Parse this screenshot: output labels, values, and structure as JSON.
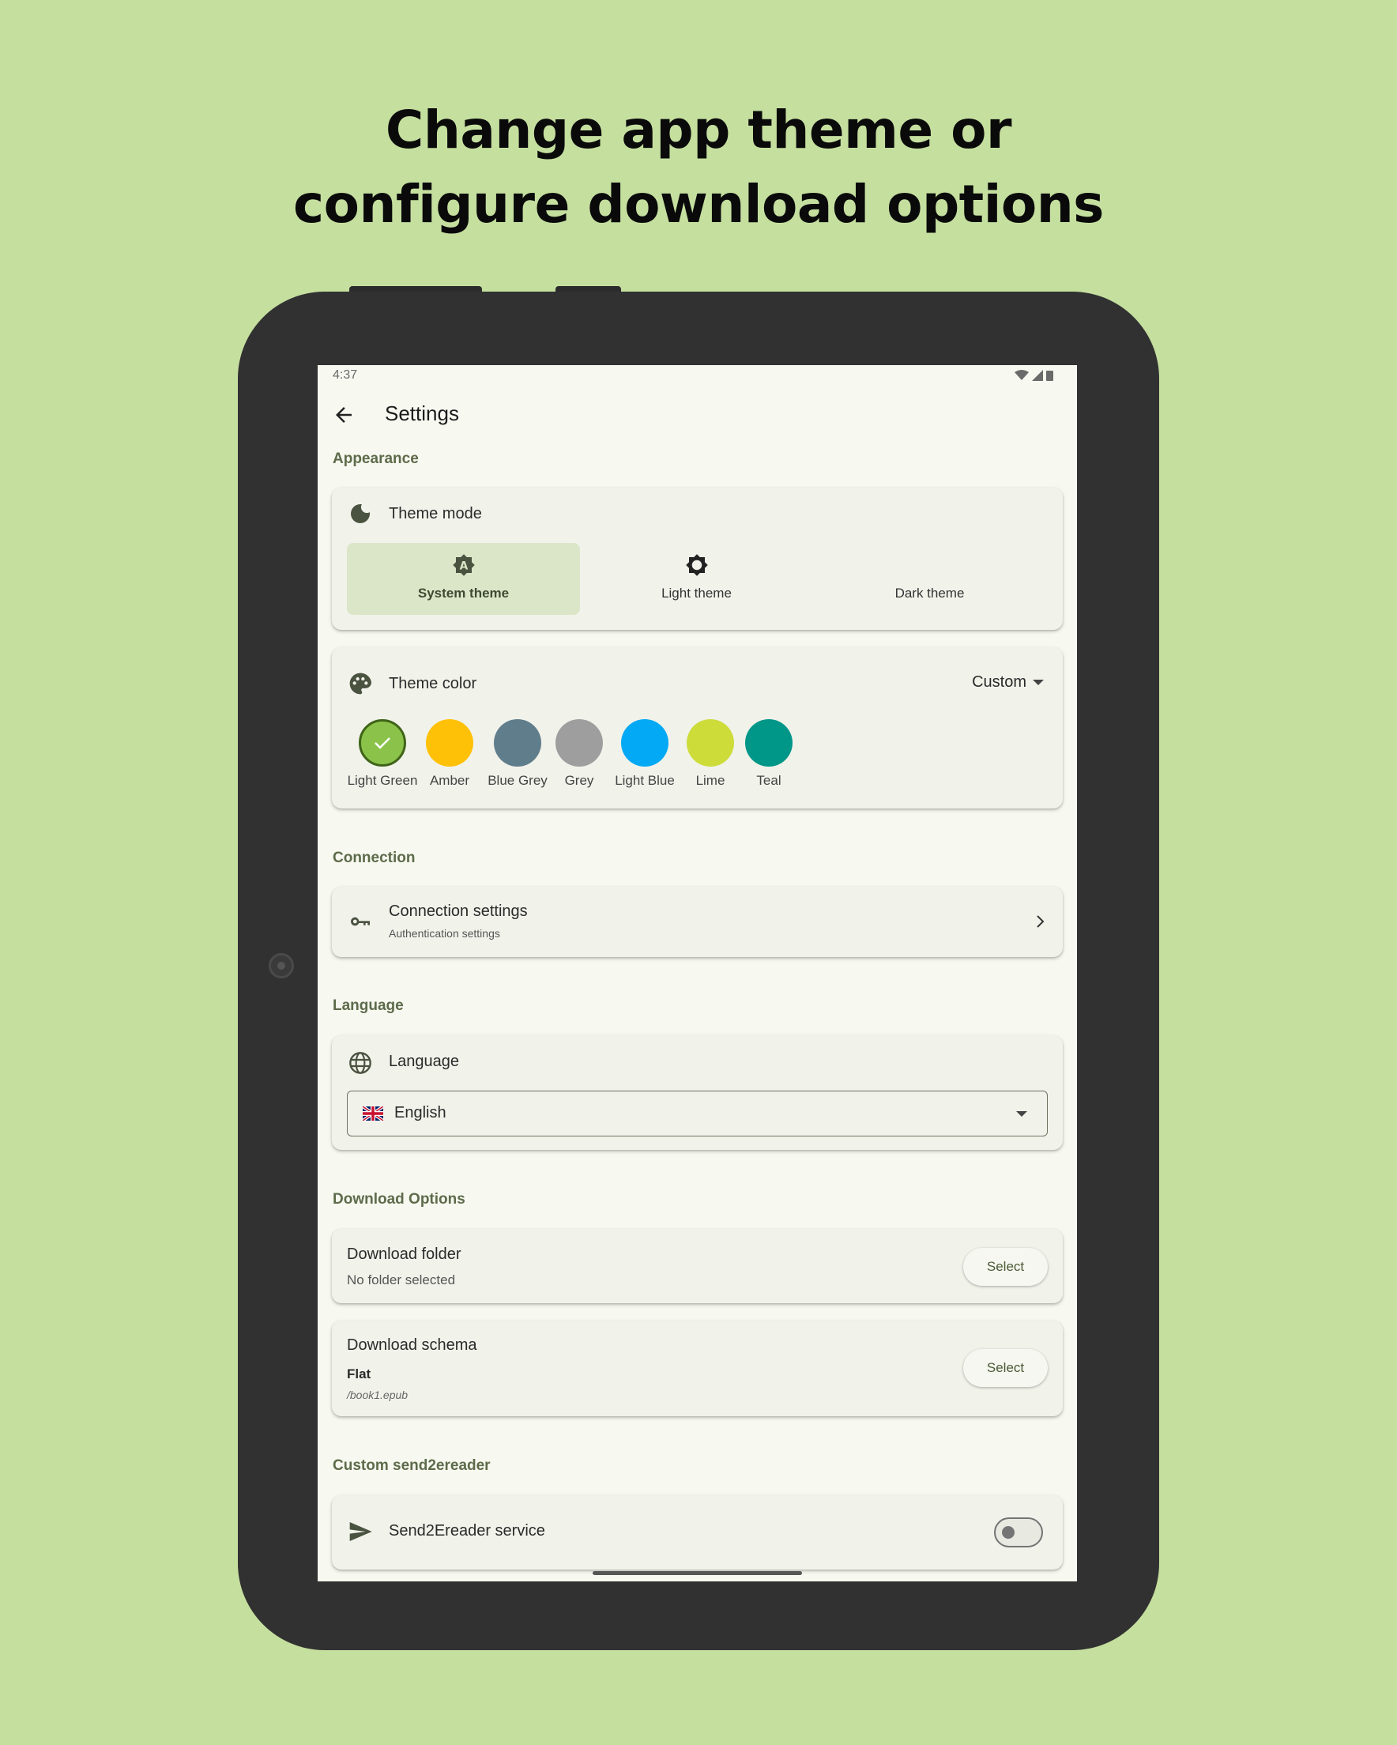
{
  "headline": {
    "line1": "Change app theme or",
    "line2": "configure download options"
  },
  "status_bar": {
    "time": "4:37",
    "icons": [
      "wifi-icon",
      "signal-icon",
      "battery-icon"
    ]
  },
  "app_bar": {
    "title": "Settings",
    "back_icon": "arrow-back-icon"
  },
  "appearance": {
    "section_label": "Appearance",
    "theme_mode": {
      "title": "Theme mode",
      "icon": "moon-icon",
      "options": [
        {
          "label": "System theme",
          "icon": "auto-brightness-icon",
          "selected": true
        },
        {
          "label": "Light theme",
          "icon": "sun-icon",
          "selected": false
        },
        {
          "label": "Dark theme",
          "icon": "moon-icon",
          "selected": false
        }
      ]
    },
    "theme_color": {
      "title": "Theme color",
      "icon": "palette-icon",
      "mode_value": "Custom",
      "swatches": [
        {
          "label": "Light Green",
          "color": "#8bc34a",
          "selected": true
        },
        {
          "label": "Amber",
          "color": "#ffc107",
          "selected": false
        },
        {
          "label": "Blue Grey",
          "color": "#607d8b",
          "selected": false
        },
        {
          "label": "Grey",
          "color": "#9e9e9e",
          "selected": false
        },
        {
          "label": "Light Blue",
          "color": "#03a9f4",
          "selected": false
        },
        {
          "label": "Lime",
          "color": "#cddc39",
          "selected": false
        },
        {
          "label": "Teal",
          "color": "#009688",
          "selected": false
        }
      ]
    }
  },
  "connection": {
    "section_label": "Connection",
    "item": {
      "title": "Connection settings",
      "subtitle": "Authentication settings",
      "icon": "key-icon"
    }
  },
  "language": {
    "section_label": "Language",
    "card_title": "Language",
    "icon": "globe-icon",
    "selected_value": "English",
    "flag": "uk-flag-icon"
  },
  "download_options": {
    "section_label": "Download Options",
    "folder": {
      "title": "Download folder",
      "value": "No folder selected",
      "button": "Select"
    },
    "schema": {
      "title": "Download schema",
      "value": "Flat",
      "example": "/book1.epub",
      "button": "Select"
    }
  },
  "send2ereader": {
    "section_label": "Custom send2ereader",
    "item": {
      "title": "Send2Ereader service",
      "icon": "send-icon",
      "enabled": false
    }
  },
  "colors": {
    "background": "#c5df9f",
    "device": "#313131",
    "screen": "#f7f8f0",
    "card": "#f1f2ea",
    "accent": "#5d6b4a",
    "selected_segment": "#dbe6c8"
  }
}
